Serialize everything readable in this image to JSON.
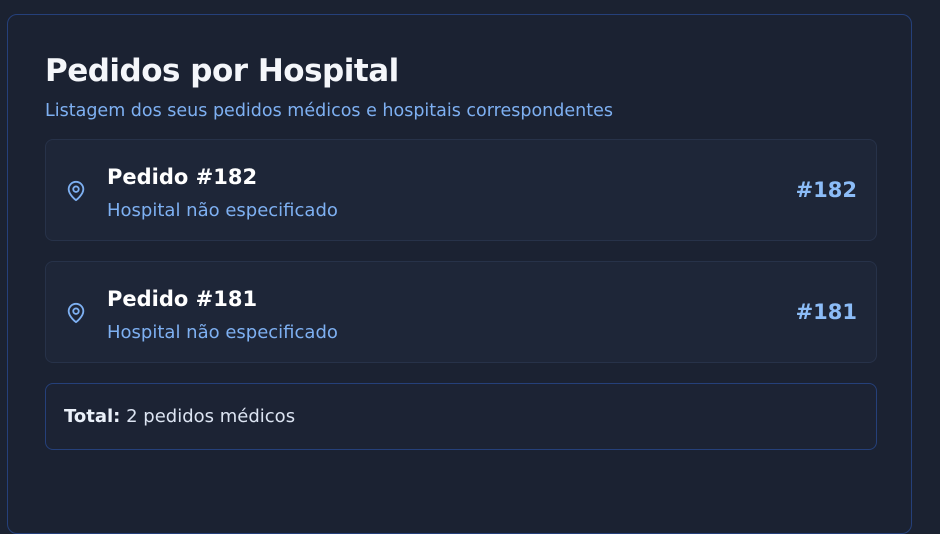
{
  "page": {
    "title": "Pedidos por Hospital",
    "subtitle": "Listagem dos seus pedidos médicos e hospitais correspondentes"
  },
  "orders": [
    {
      "name": "Pedido #182",
      "hospital": "Hospital não especificado",
      "code": "#182",
      "icon": "map-pin-icon"
    },
    {
      "name": "Pedido #181",
      "hospital": "Hospital não especificado",
      "code": "#181",
      "icon": "map-pin-icon"
    }
  ],
  "summary": {
    "label": "Total:",
    "value": "2 pedidos médicos"
  },
  "colors": {
    "background": "#1b2231",
    "accent": "#7eb0f2",
    "code": "#8cbcf7",
    "border": "#25407a"
  }
}
